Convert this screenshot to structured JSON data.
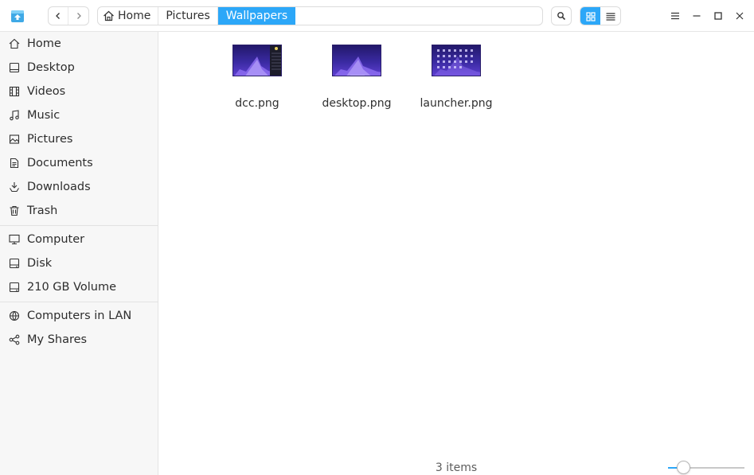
{
  "titlebar": {
    "app_icon": "file-manager-app-icon",
    "back_icon": "chevron-left-icon",
    "forward_icon": "chevron-right-icon",
    "breadcrumbs": [
      {
        "label": "Home",
        "icon": "home-icon"
      },
      {
        "label": "Pictures"
      },
      {
        "label": "Wallpapers",
        "active": true
      }
    ],
    "search_icon": "search-icon",
    "view_modes": [
      {
        "name": "icon-view",
        "icon": "grid-icon",
        "active": true
      },
      {
        "name": "list-view",
        "icon": "list-icon",
        "active": false
      }
    ],
    "window_controls": [
      "menu-icon",
      "minimize-icon",
      "maximize-icon",
      "close-icon"
    ]
  },
  "sidebar": {
    "groups": [
      [
        {
          "label": "Home",
          "icon": "home-icon"
        },
        {
          "label": "Desktop",
          "icon": "desktop-icon"
        },
        {
          "label": "Videos",
          "icon": "video-icon"
        },
        {
          "label": "Music",
          "icon": "music-icon"
        },
        {
          "label": "Pictures",
          "icon": "picture-icon"
        },
        {
          "label": "Documents",
          "icon": "document-icon"
        },
        {
          "label": "Downloads",
          "icon": "download-icon"
        },
        {
          "label": "Trash",
          "icon": "trash-icon"
        }
      ],
      [
        {
          "label": "Computer",
          "icon": "computer-icon"
        },
        {
          "label": "Disk",
          "icon": "disk-icon"
        },
        {
          "label": "210 GB Volume",
          "icon": "disk-icon"
        }
      ],
      [
        {
          "label": "Computers in LAN",
          "icon": "network-icon"
        },
        {
          "label": "My Shares",
          "icon": "share-icon"
        }
      ]
    ]
  },
  "files": [
    {
      "name": "dcc.png",
      "thumb": "dcc"
    },
    {
      "name": "desktop.png",
      "thumb": "desktop"
    },
    {
      "name": "launcher.png",
      "thumb": "launcher"
    }
  ],
  "status": {
    "item_count": "3 items",
    "zoom_level": 0.2
  },
  "colors": {
    "accent": "#2ca7f8",
    "sidebar_bg": "#f7f7f7"
  }
}
